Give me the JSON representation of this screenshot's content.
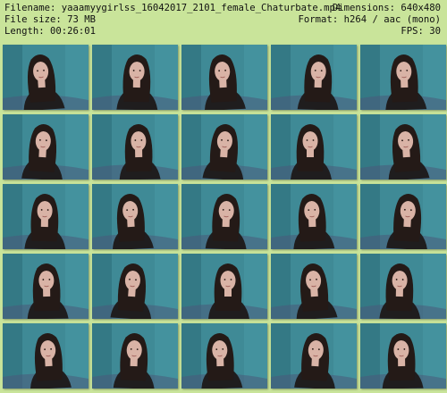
{
  "header": {
    "filename_label": "Filename: yaaamyygirlss_16042017_2101_female_Chaturbate.mp4",
    "filesize_label": "File size: 73 MB",
    "length_label": "Length: 00:26:01",
    "dimensions_label": "Dimensions: 640x480",
    "format_label": "Format: h264 / aac (mono)",
    "fps_label": "FPS: 30"
  },
  "colors": {
    "background": "#c9e49a",
    "wall": "#3f8a96",
    "hair": "#241a17",
    "skin": "#d9b3a6",
    "shirt": "#1f1d1e"
  },
  "grid": {
    "rows": 5,
    "cols": 5
  }
}
